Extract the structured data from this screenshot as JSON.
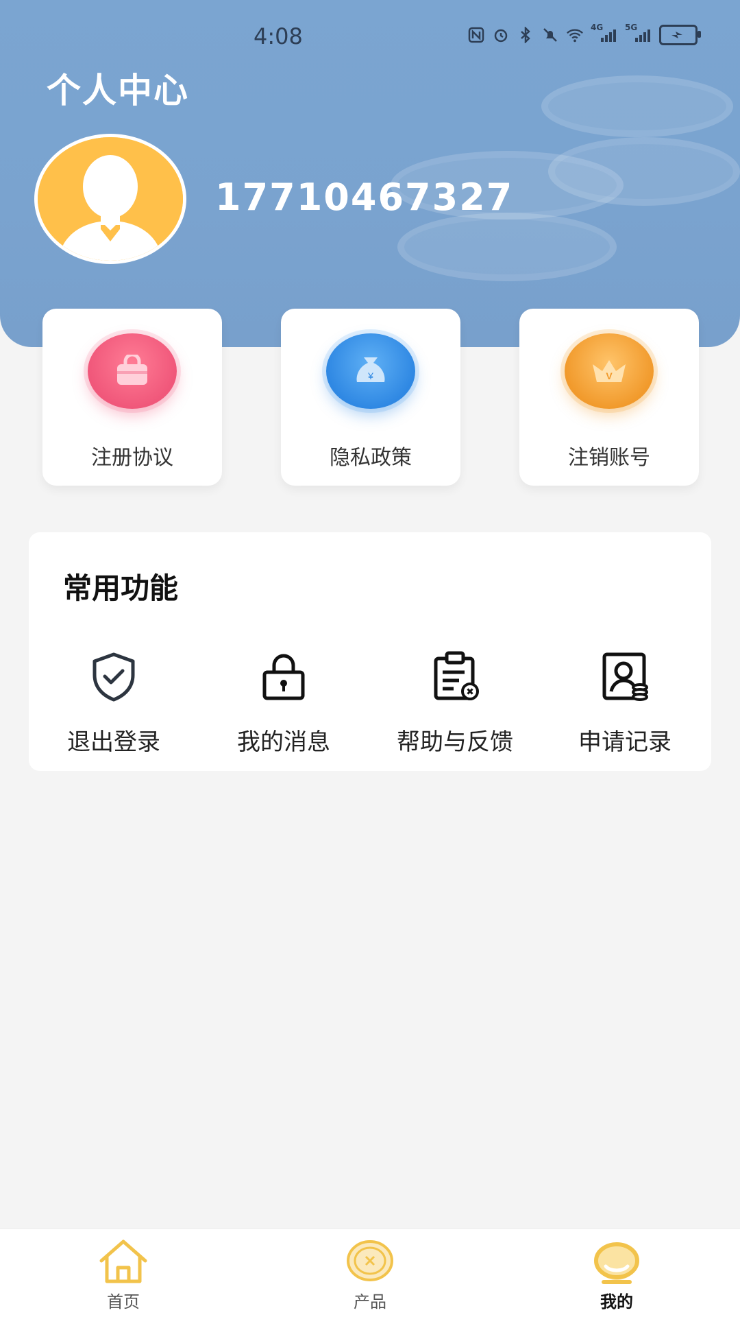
{
  "status_bar": {
    "time": "4:08",
    "icons": [
      "nfc-icon",
      "alarm-icon",
      "bluetooth-icon",
      "mute-icon",
      "wifi-icon",
      "signal-4g-icon",
      "signal-5g-icon",
      "battery-icon"
    ],
    "signal_4g": "4G",
    "signal_5g": "5G"
  },
  "header": {
    "title": "个人中心",
    "phone": "17710467327"
  },
  "quick_links": [
    {
      "label": "注册协议",
      "icon": "bag-icon",
      "color": "#f0617f"
    },
    {
      "label": "隐私政策",
      "icon": "money-bag-icon",
      "color": "#3d95ea"
    },
    {
      "label": "注销账号",
      "icon": "crown-icon",
      "color": "#f3a23b"
    }
  ],
  "common_functions": {
    "title": "常用功能",
    "items": [
      {
        "label": "退出登录",
        "icon": "shield-check-icon"
      },
      {
        "label": "我的消息",
        "icon": "lock-icon"
      },
      {
        "label": "帮助与反馈",
        "icon": "clipboard-icon"
      },
      {
        "label": "申请记录",
        "icon": "profile-record-icon"
      }
    ]
  },
  "bottom_nav": {
    "items": [
      {
        "label": "首页",
        "icon": "home-icon"
      },
      {
        "label": "产品",
        "icon": "coin-icon"
      },
      {
        "label": "我的",
        "icon": "profile-icon"
      }
    ],
    "active_index": 2,
    "accent_color": "#f2c34b"
  }
}
